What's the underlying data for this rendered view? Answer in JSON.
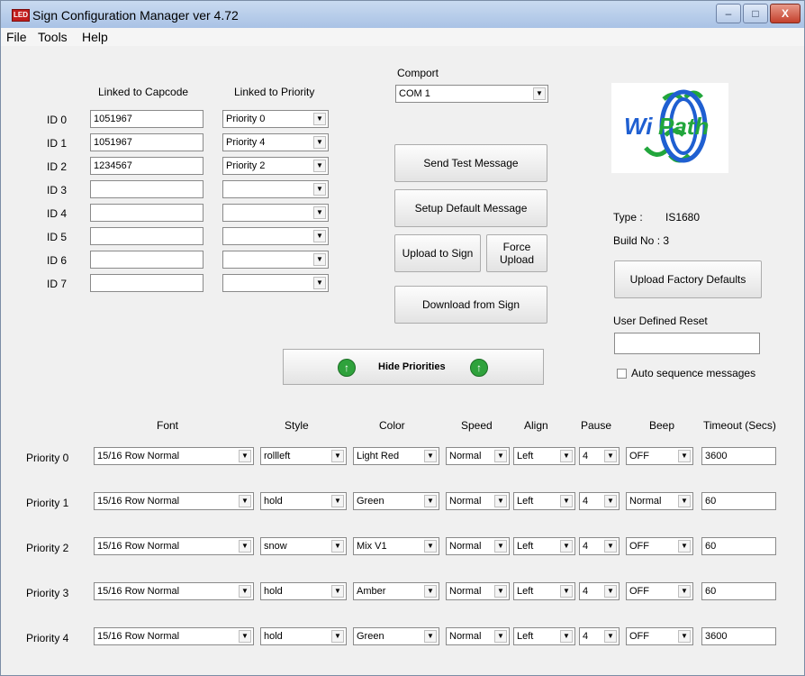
{
  "window": {
    "title": "Sign Configuration Manager ver 4.72",
    "app_icon_text": "LED",
    "buttons": {
      "minimize": "–",
      "maximize": "□",
      "close": "X"
    }
  },
  "menu": [
    "File",
    "Tools",
    "Help"
  ],
  "ids_table": {
    "header_capcode": "Linked to Capcode",
    "header_priority": "Linked to Priority",
    "rows": [
      {
        "label": "ID  0",
        "capcode": "1051967",
        "priority": "Priority 0"
      },
      {
        "label": "ID  1",
        "capcode": "1051967",
        "priority": "Priority 4"
      },
      {
        "label": "ID  2",
        "capcode": "1234567",
        "priority": "Priority 2"
      },
      {
        "label": "ID  3",
        "capcode": "",
        "priority": ""
      },
      {
        "label": "ID  4",
        "capcode": "",
        "priority": ""
      },
      {
        "label": "ID  5",
        "capcode": "",
        "priority": ""
      },
      {
        "label": "ID  6",
        "capcode": "",
        "priority": ""
      },
      {
        "label": "ID  7",
        "capcode": "",
        "priority": ""
      }
    ]
  },
  "comport": {
    "label": "Comport",
    "value": "COM 1"
  },
  "actions": {
    "send_test": "Send Test Message",
    "setup_default": "Setup Default Message",
    "upload_to_sign": "Upload to Sign",
    "force_upload_line1": "Force",
    "force_upload_line2": "Upload",
    "download_from_sign": "Download from Sign",
    "hide_priorities": "Hide Priorities"
  },
  "logo": {
    "text": "WiPath"
  },
  "device": {
    "type_label": "Type :",
    "type_value": "IS1680",
    "build_label": "Build No : 3",
    "upload_factory": "Upload Factory Defaults",
    "user_reset_label": "User Defined Reset",
    "user_reset_value": "",
    "auto_sequence": "Auto sequence messages",
    "auto_sequence_checked": false
  },
  "priorities_table": {
    "headers": [
      "Font",
      "Style",
      "Color",
      "Speed",
      "Align",
      "Pause",
      "Beep",
      "Timeout (Secs)"
    ],
    "rows": [
      {
        "label": "Priority 0",
        "font": "15/16 Row Normal",
        "style": "rollleft",
        "color": "Light Red",
        "speed": "Normal",
        "align": "Left",
        "pause": "4",
        "beep": "OFF",
        "timeout": "3600"
      },
      {
        "label": "Priority 1",
        "font": "15/16 Row Normal",
        "style": "hold",
        "color": "Green",
        "speed": "Normal",
        "align": "Left",
        "pause": "4",
        "beep": "Normal",
        "timeout": "60"
      },
      {
        "label": "Priority 2",
        "font": "15/16 Row Normal",
        "style": "snow",
        "color": "Mix V1",
        "speed": "Normal",
        "align": "Left",
        "pause": "4",
        "beep": "OFF",
        "timeout": "60"
      },
      {
        "label": "Priority 3",
        "font": "15/16 Row Normal",
        "style": "hold",
        "color": "Amber",
        "speed": "Normal",
        "align": "Left",
        "pause": "4",
        "beep": "OFF",
        "timeout": "60"
      },
      {
        "label": "Priority 4",
        "font": "15/16 Row Normal",
        "style": "hold",
        "color": "Green",
        "speed": "Normal",
        "align": "Left",
        "pause": "4",
        "beep": "OFF",
        "timeout": "3600"
      }
    ]
  },
  "colors": {
    "titlebar": "#b9cdeb",
    "window_bg": "#f0f0f0",
    "green_button": "#2fa23c",
    "logo_blue": "#1f5fd1",
    "logo_green": "#22a63c",
    "close_red": "#c4402c"
  }
}
